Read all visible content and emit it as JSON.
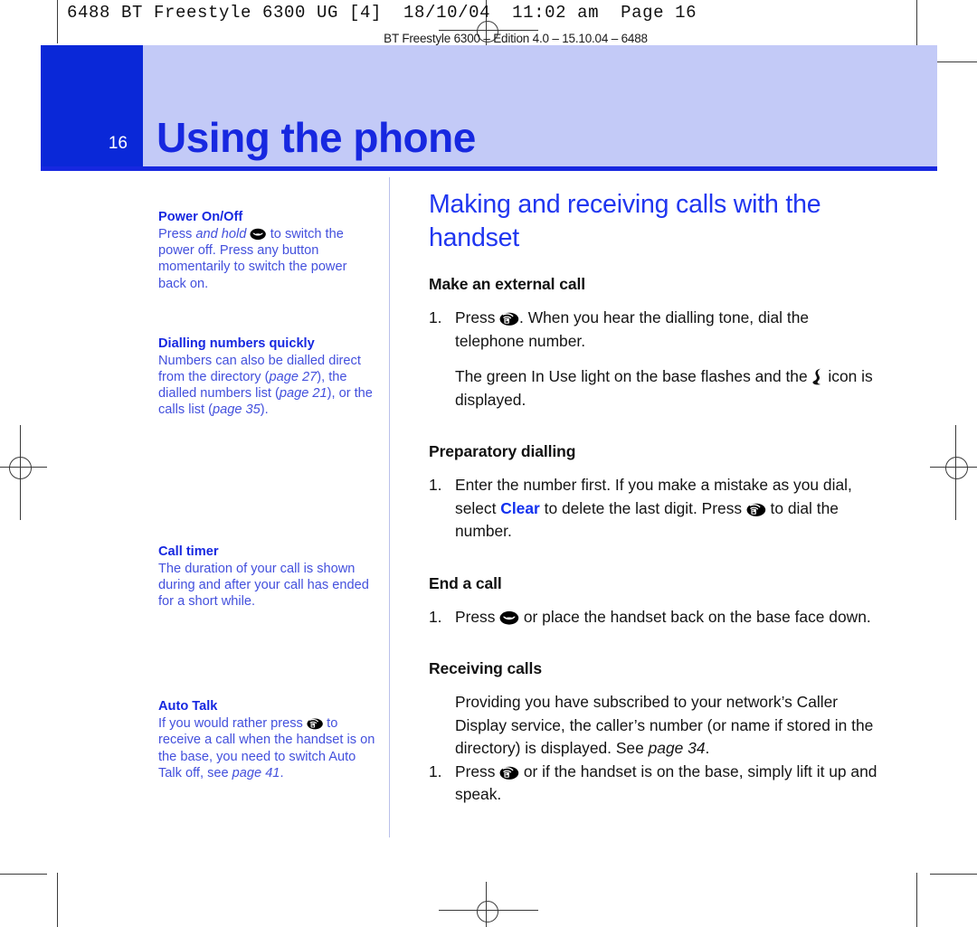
{
  "prepress": {
    "job_line": "6488 BT Freestyle 6300 UG [4]  18/10/04  11:02 am  Page 16",
    "edition_line": "BT Freestyle 6300 – Edition 4.0 – 15.10.04 – 6488"
  },
  "banner": {
    "page_number": "16",
    "title": "Using the phone",
    "tab_color": "#0a28d8",
    "field_color": "#c3caf7",
    "title_color": "#1728e0"
  },
  "sidebar": {
    "notes": [
      {
        "heading": "Power On/Off",
        "body_parts": [
          {
            "type": "text",
            "value": "Press "
          },
          {
            "type": "italic",
            "value": "and hold"
          },
          {
            "type": "text",
            "value": " "
          },
          {
            "type": "icon",
            "value": "end-call-icon"
          },
          {
            "type": "text",
            "value": " to switch the power off. Press any button momentarily to switch the power back on."
          }
        ]
      },
      {
        "heading": "Dialling numbers quickly",
        "body_parts": [
          {
            "type": "text",
            "value": "Numbers can also be dialled direct from the directory ("
          },
          {
            "type": "italic",
            "value": "page 27"
          },
          {
            "type": "text",
            "value": "), the dialled numbers list ("
          },
          {
            "type": "italic",
            "value": "page 21"
          },
          {
            "type": "text",
            "value": "), or the calls list ("
          },
          {
            "type": "italic",
            "value": "page 35"
          },
          {
            "type": "text",
            "value": ")."
          }
        ]
      },
      {
        "heading": "Call timer",
        "body_parts": [
          {
            "type": "text",
            "value": "The duration of your call is shown during and after your call has ended for a short while."
          }
        ]
      },
      {
        "heading": "Auto Talk",
        "body_parts": [
          {
            "type": "text",
            "value": "If you would rather press "
          },
          {
            "type": "icon",
            "value": "talk-icon"
          },
          {
            "type": "text",
            "value": " to receive a call when the handset is on the base, you need to switch Auto Talk off, see "
          },
          {
            "type": "italic",
            "value": "page 41"
          },
          {
            "type": "text",
            "value": "."
          }
        ]
      }
    ]
  },
  "main": {
    "title": "Making and receiving calls with the handset",
    "sections": [
      {
        "heading": "Make an external call",
        "blocks": [
          {
            "kind": "step",
            "number": "1.",
            "parts": [
              {
                "type": "text",
                "value": "Press "
              },
              {
                "type": "icon",
                "value": "talk-icon"
              },
              {
                "type": "text",
                "value": ". When you hear the dialling tone, dial the telephone number."
              }
            ]
          },
          {
            "kind": "para",
            "parts": [
              {
                "type": "text",
                "value": "The green In Use light on the base flashes and the "
              },
              {
                "type": "icon",
                "value": "in-use-icon"
              },
              {
                "type": "text",
                "value": " icon is displayed."
              }
            ]
          }
        ]
      },
      {
        "heading": "Preparatory dialling",
        "blocks": [
          {
            "kind": "step",
            "number": "1.",
            "parts": [
              {
                "type": "text",
                "value": "Enter the number first. If you make a mistake as you dial, select "
              },
              {
                "type": "accent",
                "value": "Clear"
              },
              {
                "type": "text",
                "value": " to delete the last digit. Press "
              },
              {
                "type": "icon",
                "value": "talk-icon"
              },
              {
                "type": "text",
                "value": " to dial the number."
              }
            ]
          }
        ]
      },
      {
        "heading": "End a call",
        "blocks": [
          {
            "kind": "step",
            "number": "1.",
            "parts": [
              {
                "type": "text",
                "value": "Press "
              },
              {
                "type": "icon",
                "value": "end-call-icon"
              },
              {
                "type": "text",
                "value": " or place the handset back on the base face down."
              }
            ]
          }
        ]
      },
      {
        "heading": "Receiving calls",
        "blocks": [
          {
            "kind": "para",
            "parts": [
              {
                "type": "text",
                "value": "Providing you have subscribed to your network’s Caller Display service, the caller’s number (or name if stored in the directory) is displayed. See "
              },
              {
                "type": "italic",
                "value": "page 34"
              },
              {
                "type": "text",
                "value": "."
              }
            ]
          },
          {
            "kind": "step",
            "number": "1.",
            "parts": [
              {
                "type": "text",
                "value": "Press "
              },
              {
                "type": "icon",
                "value": "talk-icon"
              },
              {
                "type": "text",
                "value": " or if the handset is on the base, simply lift it up and speak."
              }
            ]
          }
        ]
      }
    ]
  },
  "accent_color": "#1331ef",
  "text_color": "#141414"
}
